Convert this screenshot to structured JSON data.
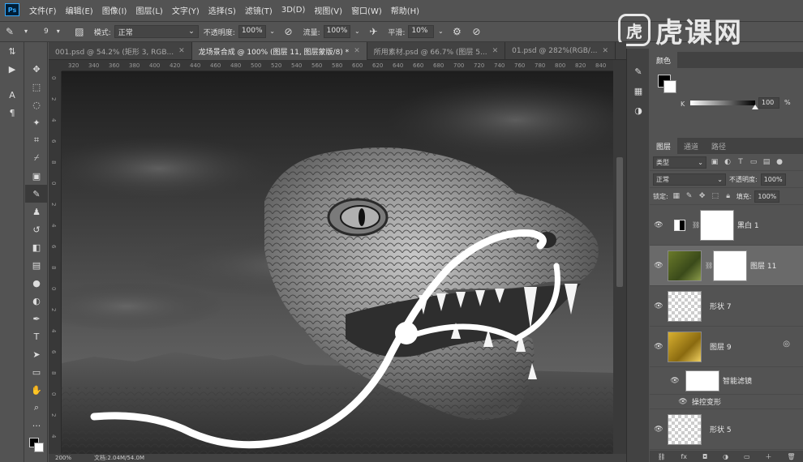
{
  "menu": {
    "logo": "Ps",
    "items": [
      "文件(F)",
      "编辑(E)",
      "图像(I)",
      "图层(L)",
      "文字(Y)",
      "选择(S)",
      "滤镜(T)",
      "3D(D)",
      "视图(V)",
      "窗口(W)",
      "帮助(H)"
    ]
  },
  "options": {
    "brush_size": "9",
    "mode_label": "模式:",
    "mode_value": "正常",
    "opacity_label": "不透明度:",
    "opacity_value": "100%",
    "flow_label": "流量:",
    "flow_value": "100%",
    "smooth_label": "平滑:",
    "smooth_value": "10%"
  },
  "watermark": {
    "logo_char": "虎",
    "text": "虎课网"
  },
  "tabs": [
    {
      "label": "001.psd @ 54.2% (矩形 3, RGB...",
      "active": false
    },
    {
      "label": "龙场景合成 @ 100% (图层 11, 图层蒙版/8) *",
      "active": true
    },
    {
      "label": "所用素材.psd @ 66.7% (图层 5...",
      "active": false
    },
    {
      "label": "01.psd @ 282%(RGB/...",
      "active": false
    }
  ],
  "ruler": {
    "h_ticks": [
      "320",
      "340",
      "360",
      "380",
      "400",
      "420",
      "440",
      "460",
      "480",
      "500",
      "520",
      "540",
      "560",
      "580",
      "600",
      "620",
      "640",
      "660",
      "680",
      "700",
      "720",
      "740",
      "760",
      "780",
      "800",
      "820",
      "840"
    ],
    "v_ticks": [
      "0",
      "2",
      "4",
      "6",
      "8",
      "0",
      "2",
      "4",
      "6",
      "8",
      "0",
      "2",
      "4",
      "6",
      "8",
      "0",
      "2",
      "4"
    ]
  },
  "status": {
    "zoom": "200%",
    "doc": "文档:2.04M/54.0M"
  },
  "color_panel": {
    "title": "颜色",
    "channel_label": "K",
    "channel_value": "100",
    "channel_unit": "%",
    "channel_level": 1.0
  },
  "layers_panel": {
    "tabs": [
      "图层",
      "通道",
      "路径"
    ],
    "filter_value": "类型",
    "blend_value": "正常",
    "opacity_label": "不透明度:",
    "opacity_value": "100%",
    "lock_label": "锁定:",
    "fill_label": "填充:",
    "fill_value": "100%",
    "layers": [
      {
        "name": "黑白 1",
        "kind": "adjustment"
      },
      {
        "name": "图层 11",
        "kind": "image-mask",
        "selected": true
      },
      {
        "name": "形状 7",
        "kind": "shape"
      },
      {
        "name": "图层 9",
        "kind": "smart"
      },
      {
        "name": "智能滤镜",
        "kind": "smart-filter"
      },
      {
        "name": "操控变形",
        "kind": "filter-item"
      },
      {
        "name": "形状 5",
        "kind": "shape"
      }
    ],
    "footer_icons": [
      "link-icon",
      "fx-icon",
      "mask-icon",
      "adjustment-icon",
      "group-icon",
      "new-layer-icon",
      "trash-icon"
    ]
  },
  "colors": {
    "panel_bg": "#535353",
    "dark_bg": "#424242",
    "accent": "#31a8ff"
  }
}
